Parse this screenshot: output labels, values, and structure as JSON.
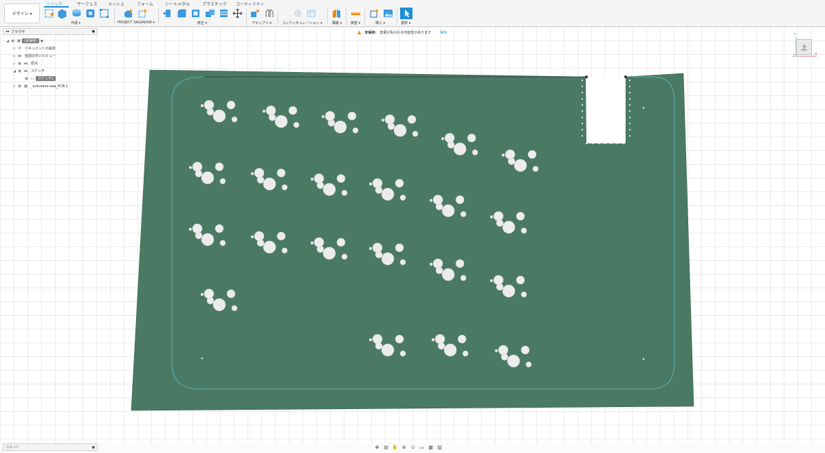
{
  "workspace": {
    "label": "デザイン ▾"
  },
  "tabs": [
    "ソリッド",
    "サーフェス",
    "メッシュ",
    "フォーム",
    "シートメタル",
    "プラスチック",
    "ユーティリティ"
  ],
  "toolbar_groups": {
    "create": "作成 ▾",
    "project": "PROJECT SALVADOR ▾",
    "modify": "修正 ▾",
    "assemble": "アセンブリ ▾",
    "configure": "コンフィギュレーション ▾",
    "construct": "構築 ▾",
    "inspect": "検査 ▾",
    "insert": "挿入 ▾",
    "select": "選択 ▾"
  },
  "notice": {
    "status": "未保存:",
    "message": "変更が失われる可能性があります",
    "save": "保存"
  },
  "browser": {
    "title": "ブラウザ",
    "items": [
      {
        "label": "(未保存)"
      },
      {
        "label": "ドキュメントの設定"
      },
      {
        "label": "名前の付いたビュー"
      },
      {
        "label": "原点"
      },
      {
        "label": "スケッチ"
      },
      {
        "label": "スケッチ1"
      },
      {
        "label": "_autosave-aaa_PCB:1"
      }
    ]
  },
  "viewcube": {
    "face": "上",
    "axis_x": "X",
    "axis_y": "Y",
    "axis_z": "Z"
  },
  "comments": {
    "title": "コメント"
  },
  "colors": {
    "board": "#4a7a64",
    "accent": "#1e8fd6",
    "sketch_line": "#62c2cc",
    "warning": "#f08a00"
  },
  "icons": [
    "sketch-icon",
    "extrude-icon",
    "revolve-icon",
    "box-icon",
    "constraint-icon",
    "project-icon",
    "push-pull-icon",
    "fillet-icon",
    "shell-icon",
    "combine-icon",
    "move-icon",
    "joint-icon",
    "config-icon",
    "plane-icon",
    "measure-icon",
    "insert-icon",
    "image-icon",
    "select-icon"
  ]
}
